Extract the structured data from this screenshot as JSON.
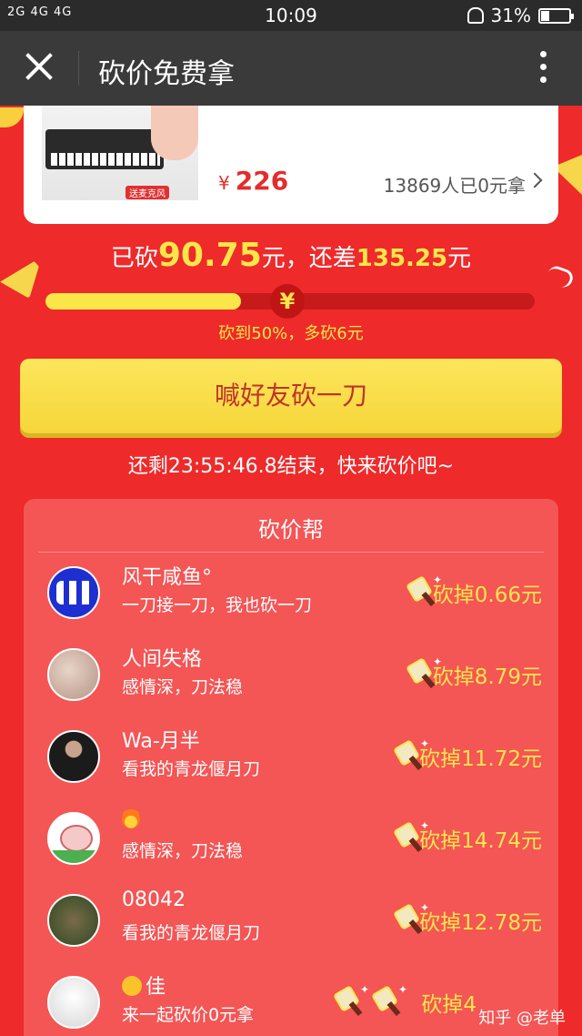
{
  "status_bar": {
    "signal": "2G 4G 4G",
    "time": "10:09",
    "battery_pct": "31%",
    "battery_level": 0.31
  },
  "nav": {
    "title": "砍价免费拿"
  },
  "product": {
    "image_caption": "送麦克风",
    "price_symbol": "¥",
    "price": "226",
    "taken_count": "13869人已0元拿"
  },
  "progress": {
    "cut_prefix": "已砍",
    "cut_amount": "90.75",
    "cut_unit": "元，",
    "remain_prefix": "还差",
    "remain_amount": "135.25",
    "remain_unit": "元",
    "knob_symbol": "¥",
    "fraction": 0.4,
    "tip": "砍到50%，多砍6元"
  },
  "cta": {
    "label": "喊好友砍一刀"
  },
  "countdown": "还剩23:55:46.8结束，快来砍价吧~",
  "helpers": {
    "title": "砍价帮",
    "rows": [
      {
        "name": "风干咸鱼°",
        "msg": "一刀接一刀，我也砍一刀",
        "cut": "砍掉0.66元",
        "knives": 1
      },
      {
        "name": "人间失格",
        "msg": "感情深，刀法稳",
        "cut": "砍掉8.79元",
        "knives": 1
      },
      {
        "name": "Wa-月半",
        "msg": "看我的青龙偃月刀",
        "cut": "砍掉11.72元",
        "knives": 1
      },
      {
        "name": "",
        "msg": "感情深，刀法稳",
        "cut": "砍掉14.74元",
        "knives": 1
      },
      {
        "name": "08042",
        "msg": "看我的青龙偃月刀",
        "cut": "砍掉12.78元",
        "knives": 1
      },
      {
        "name": "佳",
        "msg": "来一起砍价0元拿",
        "cut": "砍掉4",
        "knives": 2
      }
    ]
  },
  "watermark": "知乎 @老单"
}
